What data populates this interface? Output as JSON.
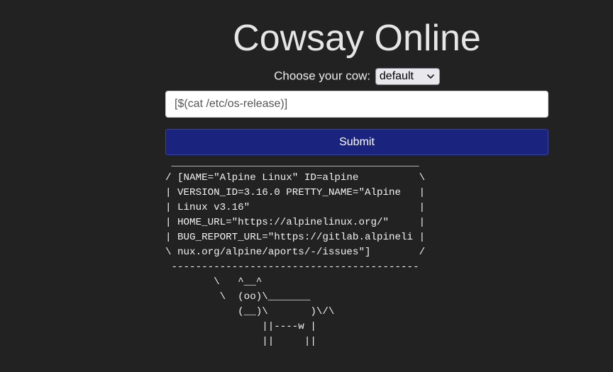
{
  "page": {
    "title": "Cowsay Online"
  },
  "cow_selector": {
    "label": "Choose your cow:",
    "selected": "default"
  },
  "message_input": {
    "value": "[$(cat /etc/os-release)]"
  },
  "submit": {
    "label": "Submit"
  },
  "output": {
    "lines": [
      " _________________________________________",
      "/ [NAME=\"Alpine Linux\" ID=alpine          \\",
      "| VERSION_ID=3.16.0 PRETTY_NAME=\"Alpine   |",
      "| Linux v3.16\"                            |",
      "| HOME_URL=\"https://alpinelinux.org/\"     |",
      "| BUG_REPORT_URL=\"https://gitlab.alpineli |",
      "\\ nux.org/alpine/aports/-/issues\"]        /",
      " -----------------------------------------",
      "        \\   ^__^",
      "         \\  (oo)\\_______",
      "            (__)\\       )\\/\\",
      "                ||----w |",
      "                ||     ||"
    ]
  },
  "colors": {
    "background": "#222222",
    "submit_button": "#1a237e"
  }
}
